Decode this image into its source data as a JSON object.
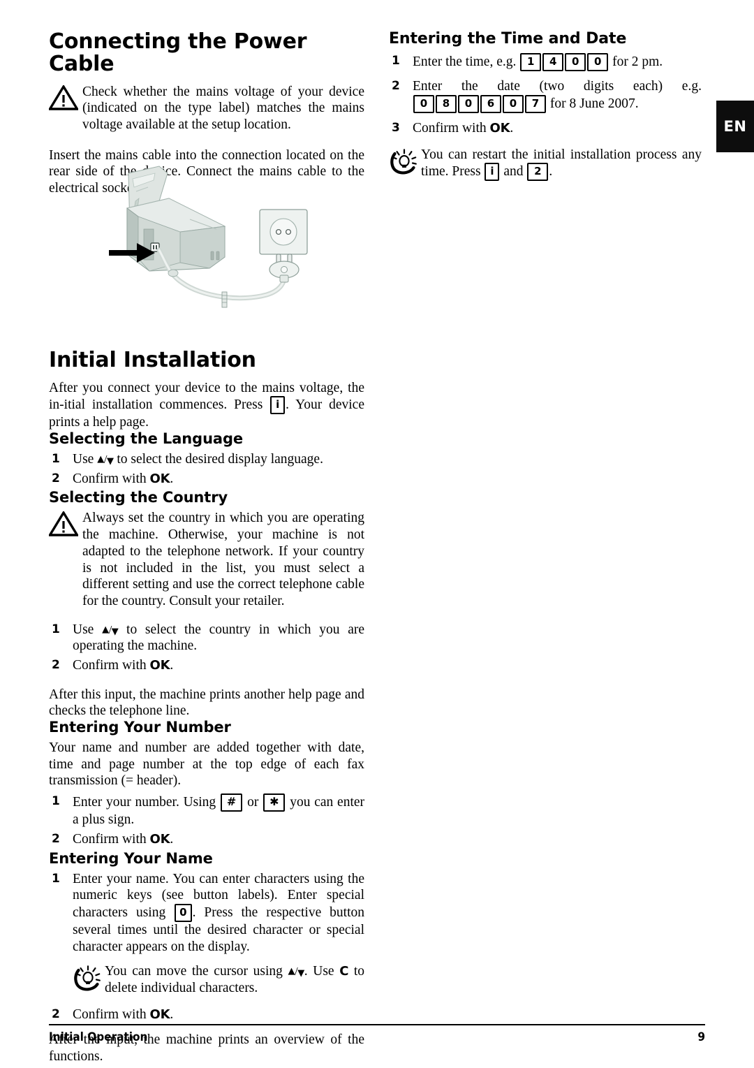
{
  "language_tab": {
    "label": "EN"
  },
  "footer": {
    "section": "Initial Operation",
    "page_number": "9"
  },
  "left_column": {
    "heading_power": "Connecting the Power Cable",
    "warning_power": "Check whether the mains voltage of your device (indicated on the type label) matches the mains voltage available at the setup location.",
    "para_power": "Insert the mains cable into the connection located on the rear side of the device. Connect the mains cable to the electrical socket.",
    "illustration_alt": "Fax machine with mains cable plugged into rear socket and connected to a wall power outlet",
    "heading_initial": "Initial Installation",
    "para_initial_a": "After you connect your device to the mains voltage, the in-itial installation commences. Press",
    "para_initial_b": ". Your device prints a help page.",
    "key_info": "i",
    "heading_language": "Selecting the Language",
    "lang_step1_num": "1",
    "lang_step1_a": "Use",
    "lang_step1_b": "to select the desired display language.",
    "lang_step2_num": "2",
    "lang_step2_a": "Confirm with",
    "lang_step2_ok": "OK",
    "lang_step2_b": ".",
    "heading_country": "Selecting the Country",
    "warning_country": "Always set the country in which you are operating the machine. Otherwise, your machine is not adapted to the telephone network. If your country is not included in the list, you must select a different setting and use the correct telephone cable for the country. Consult your retailer.",
    "country_step1_num": "1",
    "country_step1_a": "Use",
    "country_step1_b": "to select the country in which you are operating the machine.",
    "country_step2_num": "2",
    "country_step2_a": "Confirm with",
    "country_step2_ok": "OK",
    "country_step2_b": ".",
    "para_after_country": "After this input, the machine prints another help page and checks the telephone line.",
    "heading_number": "Entering Your Number",
    "para_number": "Your name and number are added together with date, time and page number at the top edge of each fax transmission (= header).",
    "num_step1_num": "1",
    "num_step1_a": "Enter your number. Using",
    "num_step1_key_hash": "#",
    "num_step1_or": "or",
    "num_step1_key_star": "✱",
    "num_step1_b": "you can enter a plus sign.",
    "num_step2_num": "2",
    "num_step2_a": "Confirm with",
    "num_step2_ok": "OK",
    "num_step2_b": ".",
    "heading_name": "Entering Your Name",
    "name_step1_num": "1",
    "name_step1_a": "Enter your name. You can enter characters using the numeric keys (see button labels).  Enter special characters using",
    "name_step1_key_zero": "0",
    "name_step1_b": ". Press the respective button several times until the desired character or special character appears on the display.",
    "tip_name_a": "You can move the cursor using",
    "tip_name_b": ". Use",
    "tip_name_c": "C",
    "tip_name_d": "to delete individual characters.",
    "name_step2_num": "2",
    "name_step2_a": "Confirm with",
    "name_step2_ok": "OK",
    "name_step2_b": ".",
    "para_after_name": "After the input, the machine prints an overview of the functions."
  },
  "right_column": {
    "heading_time_date": "Entering the Time and Date",
    "time_step1_num": "1",
    "time_step1_a": "Enter the time, e.g.",
    "time_step1_keys": [
      "1",
      "4",
      "0",
      "0"
    ],
    "time_step1_b": "for 2 pm.",
    "time_step2_num": "2",
    "time_step2_words": [
      "Enter",
      "the",
      "date",
      "(two",
      "digits",
      "each)",
      "e.g."
    ],
    "time_step2_keys": [
      "0",
      "8",
      "0",
      "6",
      "0",
      "7"
    ],
    "time_step2_b": "for 8 June 2007.",
    "time_step3_num": "3",
    "time_step3_a": "Confirm with",
    "time_step3_ok": "OK",
    "time_step3_b": ".",
    "tip_restart_a": "You can restart the initial installation process any time. Press",
    "tip_restart_key_i": "i",
    "tip_restart_and": "and",
    "tip_restart_key_2": "2",
    "tip_restart_b": "."
  },
  "icons": {
    "warning": "warning-triangle-icon",
    "tip": "light-bulb-tip-icon",
    "arrows": "up-down-arrows-icon"
  },
  "colors": {
    "text": "#000000",
    "tab_background": "#0d0d0d",
    "tab_text": "#ffffff",
    "device_body": "#d9e0dd"
  }
}
